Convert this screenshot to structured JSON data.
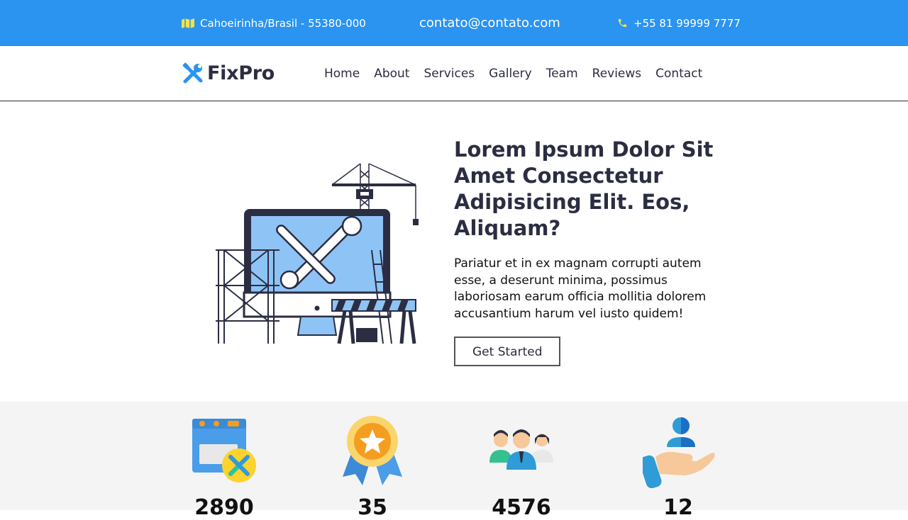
{
  "topbar": {
    "address": "Cahoeirinha/Brasil - 55380-000",
    "email": "contato@contato.com",
    "phone": "+55 81 99999 7777",
    "address_icon": "map-icon",
    "phone_icon": "phone-icon"
  },
  "brand": {
    "name": "FixPro",
    "icon": "tools-icon"
  },
  "nav": {
    "items": [
      {
        "label": "Home"
      },
      {
        "label": "About"
      },
      {
        "label": "Services"
      },
      {
        "label": "Gallery"
      },
      {
        "label": "Team"
      },
      {
        "label": "Reviews"
      },
      {
        "label": "Contact"
      }
    ]
  },
  "hero": {
    "title": "Lorem Ipsum Dolor Sit Amet Consectetur Adipisicing Elit. Eos, Aliquam?",
    "description": "Pariatur et in ex magnam corrupti autem esse, a deserunt minima, possimus laboriosam earum officia mollitia dolorem accusantium harum vel iusto quidem!",
    "button_label": "Get Started"
  },
  "stats": [
    {
      "number": "2890",
      "icon": "web-tools-icon"
    },
    {
      "number": "35",
      "icon": "award-badge-icon"
    },
    {
      "number": "4576",
      "icon": "team-people-icon"
    },
    {
      "number": "12",
      "icon": "hand-user-icon"
    }
  ],
  "colors": {
    "accent": "#2b93f0",
    "text_dark": "#2b2d42",
    "stats_bg": "#f4f4f4"
  }
}
